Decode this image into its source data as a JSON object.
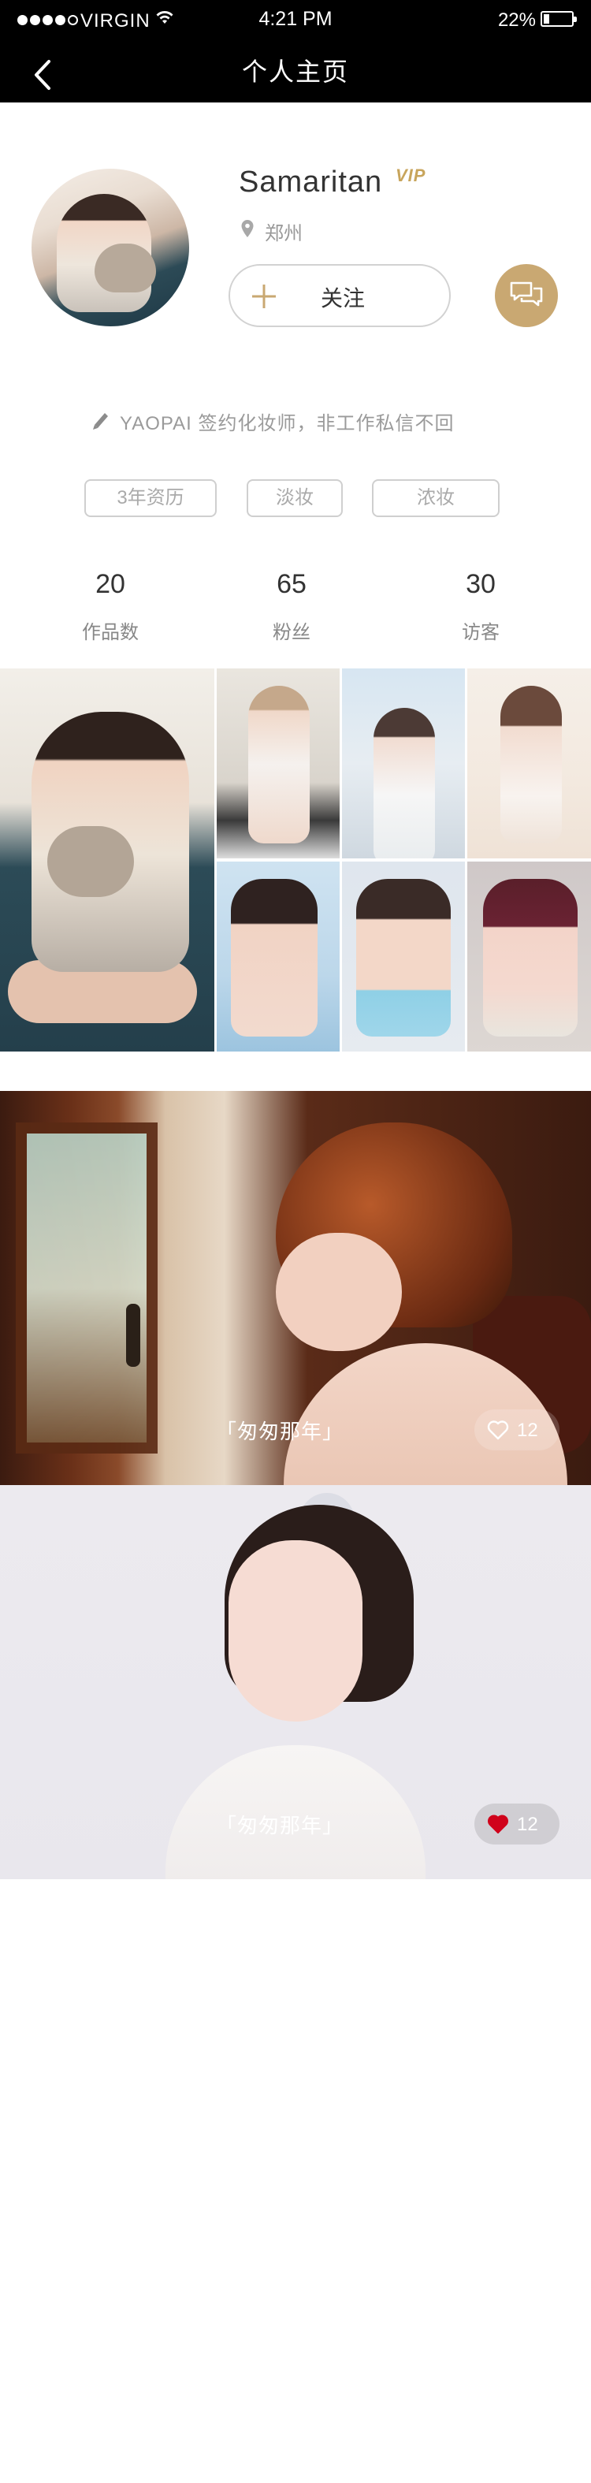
{
  "status_bar": {
    "carrier": "VIRGIN",
    "time": "4:21 PM",
    "battery": "22%",
    "battery_level": 0.22
  },
  "nav": {
    "title": "个人主页",
    "back_icon": "chevron-left-icon"
  },
  "profile": {
    "name": "Samaritan",
    "vip_badge": "VIP",
    "location": "郑州",
    "follow_label": "关注",
    "bio": "YAOPAI 签约化妆师，非工作私信不回",
    "tags": [
      "3年资历",
      "淡妆",
      "浓妆"
    ],
    "stats": [
      {
        "value": "20",
        "label": "作品数"
      },
      {
        "value": "65",
        "label": "粉丝"
      },
      {
        "value": "30",
        "label": "访客"
      }
    ]
  },
  "feed": [
    {
      "title": "「匆匆那年」",
      "likes": "12",
      "liked": false
    },
    {
      "title": "「匆匆那年」",
      "likes": "12",
      "liked": true
    }
  ],
  "colors": {
    "accent_gold": "#c9a872",
    "vip_gold": "#c8a55c",
    "liked_red": "#d0021b",
    "top_bar": "#000000"
  }
}
